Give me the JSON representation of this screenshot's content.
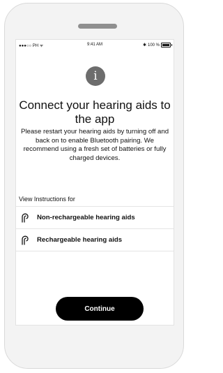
{
  "status_bar": {
    "carrier": "●●●○○ PH",
    "time": "9:41 AM",
    "bluetooth": "✱",
    "battery_label": "100 %"
  },
  "dialog": {
    "icon": "info-icon",
    "icon_glyph": "i",
    "title": "Connect your hearing aids to the app",
    "description": "Please restart your hearing aids by turning off and back on to enable Bluetooth pairing. We recommend using a fresh set of batteries or fully charged devices."
  },
  "instructions": {
    "label": "View Instructions for",
    "items": [
      {
        "icon": "hearing-aid-icon",
        "label": "Non-rechargeable hearing aids"
      },
      {
        "icon": "hearing-aid-icon",
        "label": "Rechargeable hearing aids"
      }
    ]
  },
  "actions": {
    "continue_label": "Continue"
  }
}
